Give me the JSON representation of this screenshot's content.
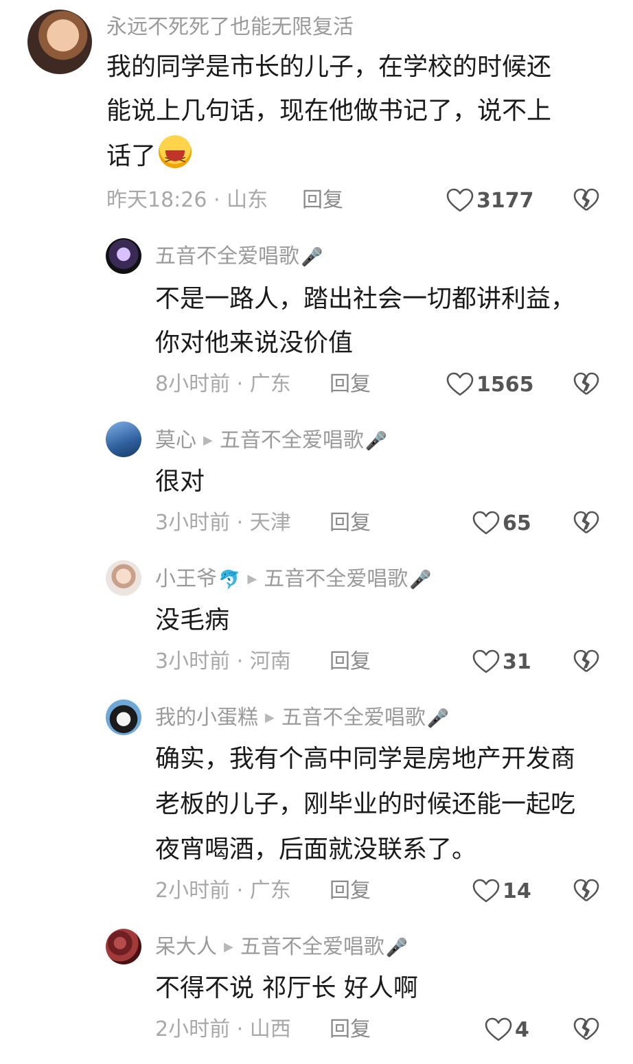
{
  "comments": [
    {
      "user": "永远不死死了也能无限复活",
      "text_lines": [
        "我的同学是市长的儿子，在学校的时候还",
        "能说上几句话，现在他做书记了，说不上",
        "话了"
      ],
      "time": "昨天18:26 · 山东",
      "reply": "回复",
      "likes": "3177"
    },
    {
      "user": "五音不全爱唱歌",
      "user_emoji": "🎤",
      "text_lines": [
        "不是一路人，踏出社会一切都讲利益，",
        "你对他来说没价值"
      ],
      "time": "8小时前 · 广东",
      "reply": "回复",
      "likes": "1565"
    },
    {
      "user": "莫心",
      "reply_to": "五音不全爱唱歌",
      "reply_to_emoji": "🎤",
      "text_lines": [
        "很对"
      ],
      "time": "3小时前 · 天津",
      "reply": "回复",
      "likes": "65"
    },
    {
      "user": "小王爷",
      "user_emoji": "🐬",
      "reply_to": "五音不全爱唱歌",
      "reply_to_emoji": "🎤",
      "text_lines": [
        "没毛病"
      ],
      "time": "3小时前 · 河南",
      "reply": "回复",
      "likes": "31"
    },
    {
      "user": "我的小蛋糕",
      "reply_to": "五音不全爱唱歌",
      "reply_to_emoji": "🎤",
      "text_lines": [
        "确实，我有个高中同学是房地产开发商",
        "老板的儿子，刚毕业的时候还能一起吃",
        "夜宵喝酒，后面就没联系了。"
      ],
      "time": "2小时前 · 广东",
      "reply": "回复",
      "likes": "14"
    },
    {
      "user": "呆大人",
      "reply_to": "五音不全爱唱歌",
      "reply_to_emoji": "🎤",
      "text_lines": [
        "不得不说 祁厅长 好人啊"
      ],
      "time": "2小时前 · 山西",
      "reply": "回复",
      "likes": "4"
    }
  ],
  "icons": {
    "like": "heart-outline-icon",
    "dislike": "broken-heart-icon",
    "reply_arrow": "triangle-right-icon",
    "laugh": "laughing-face-emoji"
  }
}
